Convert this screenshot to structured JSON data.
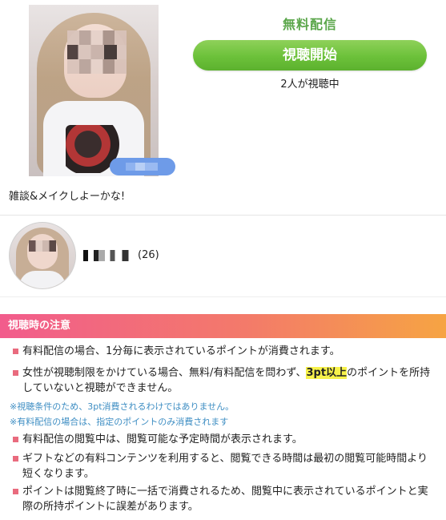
{
  "stream": {
    "free_label": "無料配信",
    "watch_button": "視聴開始",
    "viewers": "2人が視聴中",
    "title_message": "雑談&メイクしよーかな!"
  },
  "profile": {
    "age": "(26)"
  },
  "notice": {
    "header": "視聴時の注意",
    "item1": "有料配信の場合、1分毎に表示されているポイントが消費されます。",
    "item2_prefix": "女性が視聴制限をかけている場合、無料/有料配信を問わず、",
    "item2_highlight": "3pt以上",
    "item2_suffix": "のポイントを所持していないと視聴ができません。",
    "sub1": "※視聴条件のため、3pt消費されるわけではありません。",
    "sub2": "※有料配信の場合は、指定のポイントのみ消費されます",
    "item3": "有料配信の閲覧中は、閲覧可能な予定時間が表示されます。",
    "item4": "ギフトなどの有料コンテンツを利用すると、閲覧できる時間は最初の閲覧可能時間より短くなります。",
    "item5": "ポイントは閲覧終了時に一括で消費されるため、閲覧中に表示されているポイントと実際の所持ポイントに誤差があります。"
  },
  "colors": {
    "free_label": "#5aa64a",
    "button_green": "#6cc13a",
    "header_pink": "#f25c8c",
    "header_orange": "#f6a443",
    "bullet": "#e96b7e",
    "note_blue": "#3e8ec3",
    "highlight": "#f7f24a"
  }
}
